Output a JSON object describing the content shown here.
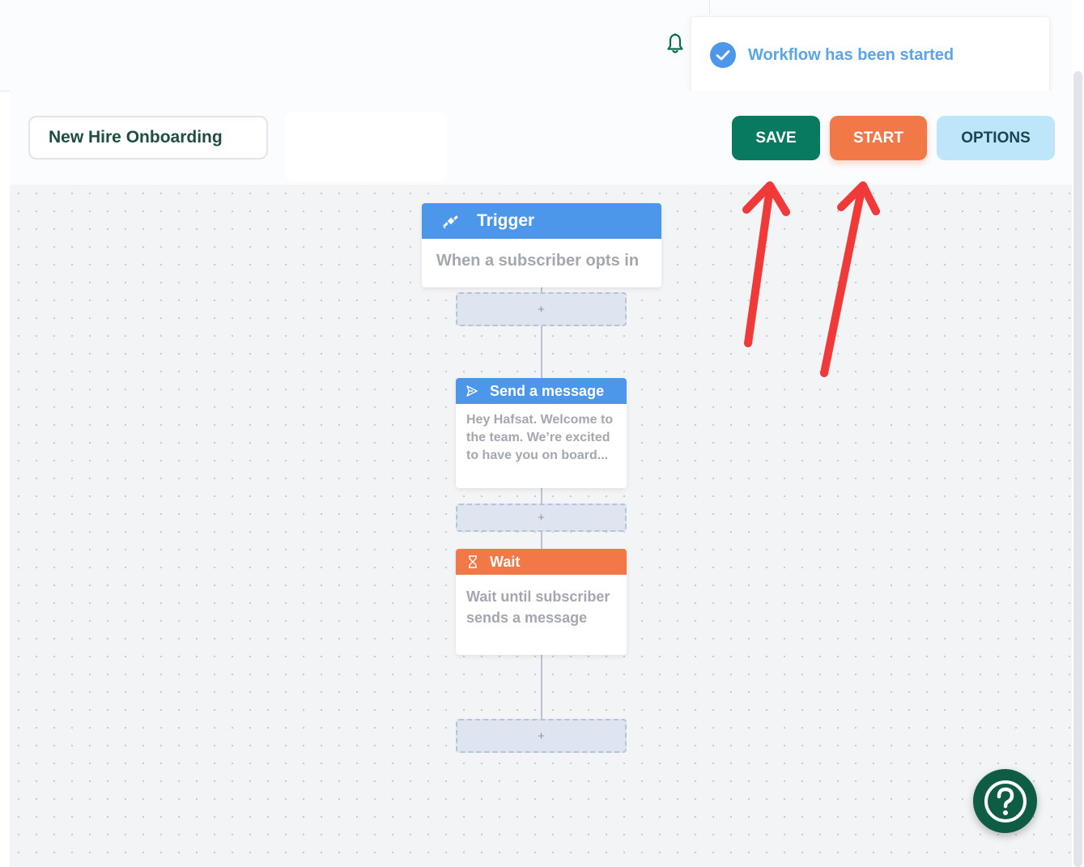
{
  "toast": {
    "message": "Workflow has been started",
    "icon": "check-circle-icon",
    "color": "#5aa4ea"
  },
  "header": {
    "notification_icon": "bell-icon"
  },
  "toolbar": {
    "workflow_name": "New Hire Onboarding",
    "save_label": "SAVE",
    "start_label": "START",
    "options_label": "OPTIONS"
  },
  "workflow": {
    "trigger": {
      "title": "Trigger",
      "icon": "satellite-icon",
      "description": "When a subscriber opts in"
    },
    "send_message": {
      "title": "Send a message",
      "icon": "send-icon",
      "body": "Hey Hafsat. Welcome to the team. We’re excited to have you on board..."
    },
    "wait": {
      "title": "Wait",
      "icon": "hourglass-icon",
      "body": "Wait until subscriber sends a message"
    },
    "add_step_label": "+"
  },
  "help": {
    "icon": "question-icon"
  },
  "colors": {
    "save": "#087a5f",
    "start": "#f27847",
    "options": "#bde6fb",
    "node_blue": "#4d97ea",
    "node_orange": "#f27847",
    "annotation_arrow": "#f03a3a"
  }
}
